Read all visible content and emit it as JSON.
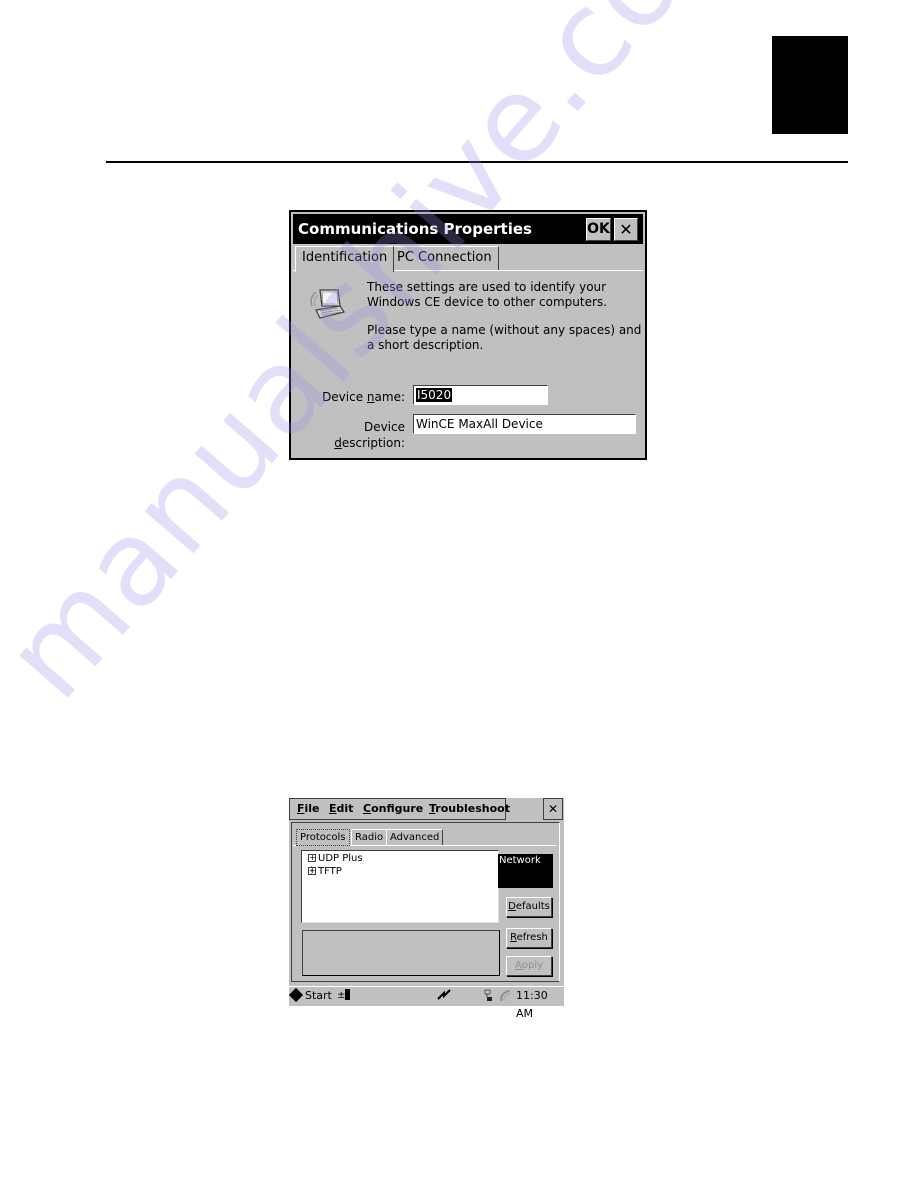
{
  "page": {
    "chapter_tab_color": "#000000"
  },
  "watermark": {
    "text": "manualshive.com",
    "color": "#968ceb"
  },
  "comm_dialog": {
    "title": "Communications Properties",
    "ok_label": "OK",
    "close_label": "✕",
    "tabs": [
      {
        "label": "Identification",
        "active": true
      },
      {
        "label": "PC Connection",
        "active": false
      }
    ],
    "icon": "laptop-icon",
    "description_1": "These settings are used to identify your Windows CE device to other computers.",
    "description_2": "Please type a name (without any spaces) and a short description.",
    "device_name_label_pre": "Device ",
    "device_name_label_ul": "n",
    "device_name_label_post": "ame:",
    "device_name_value": "I5020",
    "device_description_label_pre": "Device ",
    "device_description_label_ul": "d",
    "device_description_label_post": "escription:",
    "device_description_value": "WinCE MaxAll Device"
  },
  "network_dialog": {
    "menu": [
      {
        "ul": "F",
        "rest": "ile"
      },
      {
        "ul": "E",
        "rest": "dit"
      },
      {
        "ul": "C",
        "rest": "onfigure"
      },
      {
        "ul": "T",
        "rest": "roubleshoot"
      }
    ],
    "close_label": "✕",
    "tabs": [
      {
        "label": "Protocols",
        "active": true
      },
      {
        "label": "Radio",
        "active": false
      },
      {
        "label": "Advanced",
        "active": false
      }
    ],
    "tree_items": [
      {
        "expander": "+",
        "label": "UDP Plus"
      },
      {
        "expander": "+",
        "label": "TFTP"
      }
    ],
    "network_label": "Network",
    "buttons": {
      "defaults_ul": "D",
      "defaults_rest": "efaults",
      "refresh_ul": "R",
      "refresh_rest": "efresh",
      "apply_ul": "A",
      "apply_rest": "pply",
      "apply_enabled": false
    }
  },
  "taskbar": {
    "start_label": "Start",
    "battery_sign": "±",
    "signal_glyph": "⚡",
    "clock": "11:30 AM"
  }
}
